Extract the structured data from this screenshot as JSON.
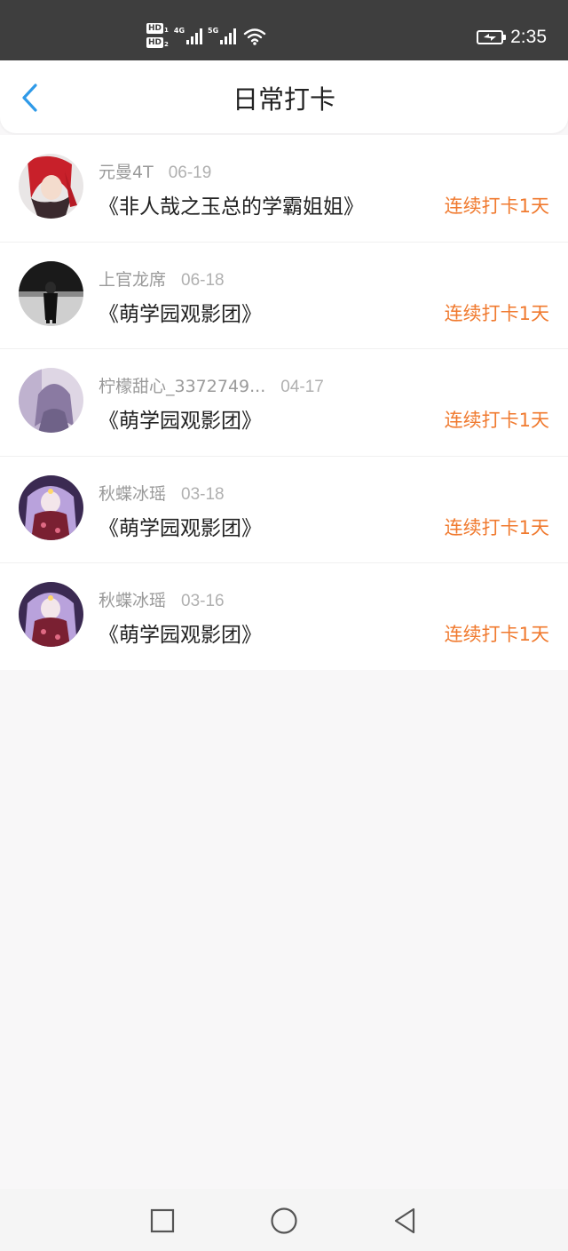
{
  "status_bar": {
    "sim1_label": "HD",
    "sim1_index": "1",
    "sim2_label": "HD",
    "sim2_index": "2",
    "network1": "4G",
    "network2": "5G",
    "time": "2:35"
  },
  "header": {
    "title": "日常打卡"
  },
  "checkins": [
    {
      "username": "元曼4T",
      "date": "06-19",
      "group": "《非人哉之玉总的学霸姐姐》",
      "streak": "连续打卡1天"
    },
    {
      "username": "上官龙席",
      "date": "06-18",
      "group": "《萌学园观影团》",
      "streak": "连续打卡1天"
    },
    {
      "username": "柠檬甜心_3372749...",
      "date": "04-17",
      "group": "《萌学园观影团》",
      "streak": "连续打卡1天"
    },
    {
      "username": "秋蝶冰瑶",
      "date": "03-18",
      "group": "《萌学园观影团》",
      "streak": "连续打卡1天"
    },
    {
      "username": "秋蝶冰瑶",
      "date": "03-16",
      "group": "《萌学园观影团》",
      "streak": "连续打卡1天"
    }
  ],
  "colors": {
    "accent": "#2f9ae8",
    "streak": "#f07a2f",
    "status_bar_bg": "#3e3e3e",
    "page_bg": "#f8f7f8"
  },
  "icons": {
    "back": "chevron-left-icon",
    "nav_recent": "square-icon",
    "nav_home": "circle-icon",
    "nav_back": "triangle-left-icon"
  }
}
